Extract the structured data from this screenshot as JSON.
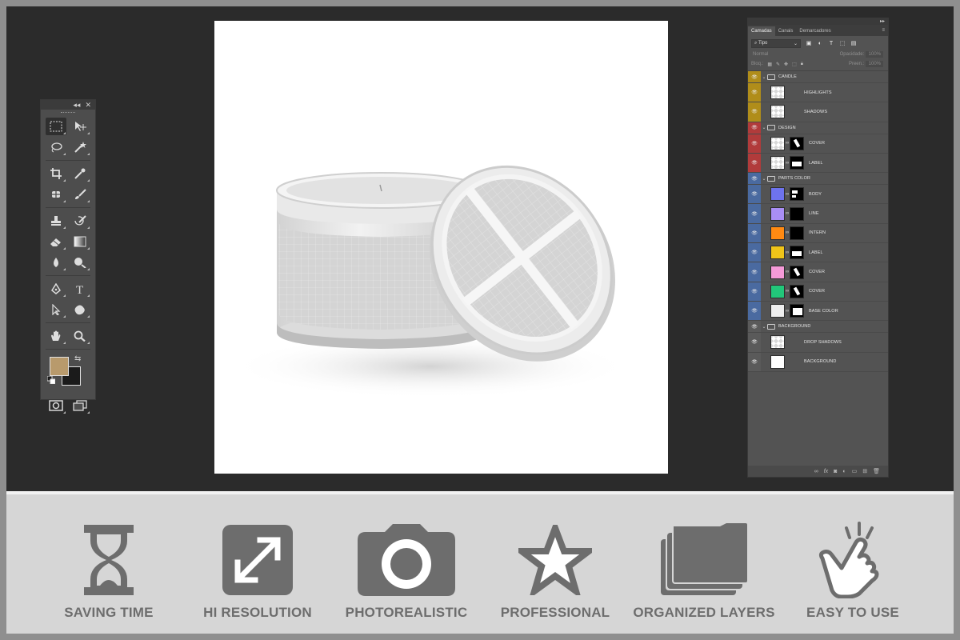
{
  "colors": {
    "candle_group": "#b08d1a",
    "design_group": "#b13b3b",
    "parts_group": "#4a6aa0",
    "bg_group": "#5a5a5a",
    "foreground_swatch": "#b89a6c",
    "feature_text": "#6d6d6d"
  },
  "tools": {
    "collapse_label": "◂◂",
    "close_label": "✕",
    "rows": [
      [
        "marquee-icon",
        "move-icon"
      ],
      [
        "lasso-icon",
        "magic-wand-icon"
      ],
      [
        "crop-icon",
        "eyedropper-icon"
      ],
      [
        "healing-brush-icon",
        "brush-icon"
      ],
      [
        "clone-stamp-icon",
        "history-brush-icon"
      ],
      [
        "eraser-icon",
        "gradient-icon"
      ],
      [
        "blur-icon",
        "dodge-icon"
      ],
      [
        "pen-icon",
        "type-icon"
      ],
      [
        "path-selection-icon",
        "shape-icon"
      ],
      [
        "hand-icon",
        "zoom-icon"
      ]
    ]
  },
  "layers_panel": {
    "collapse_label": "▸▸",
    "tabs": [
      "Camadas",
      "Canais",
      "Demarcadores"
    ],
    "kind_filter": "Tipo",
    "blend_mode": "Normal",
    "opacity_label": "Opacidade:",
    "opacity_value": "100%",
    "lock_label": "Bloq.:",
    "fill_label": "Preen.:",
    "fill_value": "100%",
    "layers": [
      {
        "name": "CANDLE",
        "type": "group",
        "color": "candle"
      },
      {
        "name": "HIGHLIGHTS",
        "type": "layer",
        "color": "candle",
        "thumb": "checker",
        "mask": false
      },
      {
        "name": "SHADOWS",
        "type": "layer",
        "color": "candle",
        "thumb": "checker",
        "mask": false
      },
      {
        "name": "DESIGN",
        "type": "group",
        "color": "design"
      },
      {
        "name": "COVER",
        "type": "layer",
        "color": "design",
        "thumb": "checker",
        "mask": true
      },
      {
        "name": "LABEL",
        "type": "layer",
        "color": "design",
        "thumb": "checker",
        "mask": true
      },
      {
        "name": "PARTS COLOR",
        "type": "group",
        "color": "parts"
      },
      {
        "name": "BODY",
        "type": "layer",
        "color": "parts",
        "thumb": "#6e73ee",
        "mask": true
      },
      {
        "name": "LINE",
        "type": "layer",
        "color": "parts",
        "thumb": "#a98ef5",
        "mask": true
      },
      {
        "name": "INTERN",
        "type": "layer",
        "color": "parts",
        "thumb": "#ff8a12",
        "mask": true
      },
      {
        "name": "LABEL",
        "type": "layer",
        "color": "parts",
        "thumb": "#f0c419",
        "mask": true
      },
      {
        "name": "COVER",
        "type": "layer",
        "color": "parts",
        "thumb": "#f59ad8",
        "mask": true
      },
      {
        "name": "COVER",
        "type": "layer",
        "color": "parts",
        "thumb": "#22c77a",
        "mask": true
      },
      {
        "name": "BASE COLOR",
        "type": "layer",
        "color": "parts",
        "thumb": "#eeeeee",
        "mask": true
      },
      {
        "name": "BACKGROUND",
        "type": "group",
        "color": "bg"
      },
      {
        "name": "DROP SHADOWS",
        "type": "layer",
        "color": "bg",
        "thumb": "checker",
        "mask": false
      },
      {
        "name": "BACKGROUND",
        "type": "layer",
        "color": "bg",
        "thumb": "#ffffff",
        "mask": false
      }
    ]
  },
  "features": [
    {
      "label": "SAVING TIME",
      "icon": "hourglass-icon"
    },
    {
      "label": "HI RESOLUTION",
      "icon": "expand-arrows-icon"
    },
    {
      "label": "PHOTOREALISTIC",
      "icon": "camera-icon"
    },
    {
      "label": "PROFESSIONAL",
      "icon": "star-icon"
    },
    {
      "label": "ORGANIZED LAYERS",
      "icon": "stacked-folders-icon"
    },
    {
      "label": "EASY TO USE",
      "icon": "tap-hand-icon"
    }
  ]
}
